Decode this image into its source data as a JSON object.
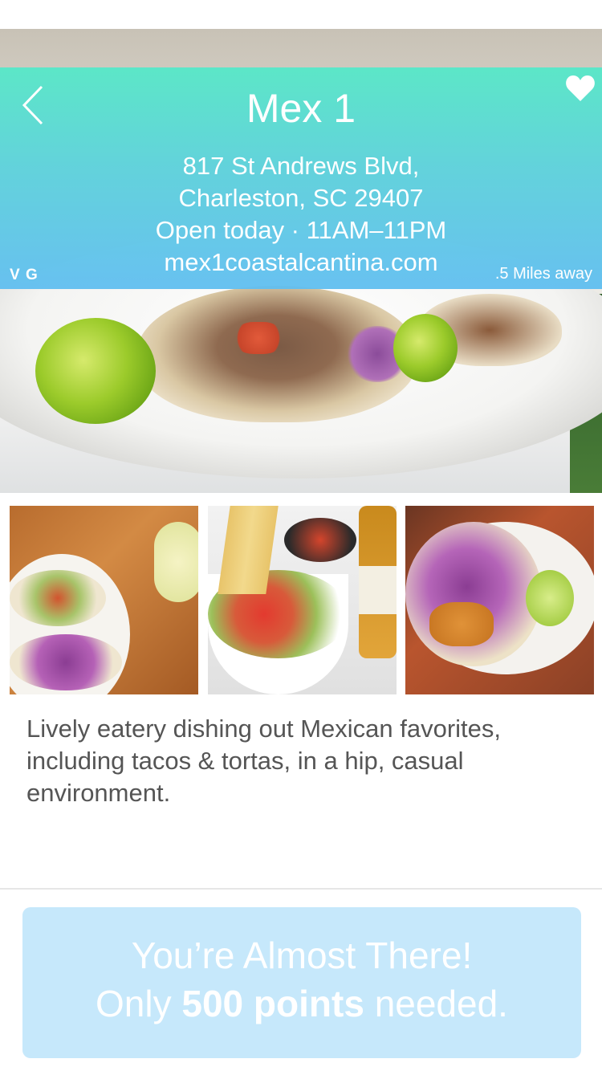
{
  "restaurant": {
    "name": "Mex 1",
    "address_line1": "817 St Andrews Blvd,",
    "address_line2": "Charleston, SC 29407",
    "hours": "Open today · 11AM–11PM",
    "website": "mex1coastalcantina.com",
    "tags": "V G",
    "distance": ".5 Miles away"
  },
  "icons": {
    "back": "chevron-left-icon",
    "favorite": "heart-icon"
  },
  "gallery": {
    "photos": [
      "tacos-and-margarita-photo",
      "chips-salsa-bowl-photo",
      "fried-fish-taco-photo"
    ]
  },
  "description": "Lively eatery dishing out Mexican favorites, including tacos & tortas, in a hip, casual environment.",
  "reward": {
    "headline": "You’re Almost There!",
    "prefix": "Only",
    "points": "500 points",
    "suffix": "needed."
  },
  "colors": {
    "overlay_top": "#56e8c8",
    "overlay_bottom": "#60bef0",
    "cta_background": "#c6e8fb",
    "body_text": "#555555"
  }
}
